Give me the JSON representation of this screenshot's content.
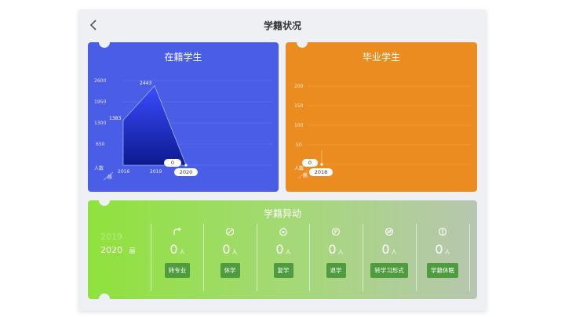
{
  "header": {
    "title": "学籍状况",
    "back_icon": "chevron-left-icon"
  },
  "current": {
    "title": "在籍学生",
    "y_ticks": [
      "2600",
      "1950",
      "1300",
      "650"
    ],
    "x_ticks": [
      "2016",
      "2019",
      "2020"
    ],
    "corner_label_top": "人数",
    "corner_label_bottom": "届",
    "bubble": "0",
    "selected_year": "2020",
    "chart_data": {
      "type": "area",
      "x": [
        "2016",
        "2019",
        "2020"
      ],
      "values": [
        1383,
        2443,
        0
      ],
      "data_labels": [
        "1383",
        "2443"
      ],
      "ylim": [
        0,
        2600
      ]
    }
  },
  "graduated": {
    "title": "毕业学生",
    "y_ticks": [
      "200",
      "150",
      "100",
      "50"
    ],
    "x_ticks": [
      "2018"
    ],
    "corner_label_top": "人数",
    "corner_label_bottom": "届",
    "bubble": "0",
    "chart_data": {
      "type": "line",
      "x": [
        "2018"
      ],
      "values": [
        0
      ],
      "ylim": [
        0,
        200
      ]
    }
  },
  "changes": {
    "title": "学籍异动",
    "year_prev": "2019",
    "year_current": "2020",
    "year_suffix": "届",
    "items": [
      {
        "icon": "redo-arrow-icon",
        "count": "0",
        "unit": "人",
        "label": "转专业"
      },
      {
        "icon": "pause-slash-icon",
        "count": "0",
        "unit": "人",
        "label": "休学"
      },
      {
        "icon": "resume-icon",
        "count": "0",
        "unit": "人",
        "label": "复学"
      },
      {
        "icon": "exit-icon",
        "count": "0",
        "unit": "人",
        "label": "退学"
      },
      {
        "icon": "transfer-mode-icon",
        "count": "0",
        "unit": "人",
        "label": "转学习形式"
      },
      {
        "icon": "sleep-info-icon",
        "count": "0",
        "unit": "人",
        "label": "学籍休眠"
      }
    ]
  }
}
